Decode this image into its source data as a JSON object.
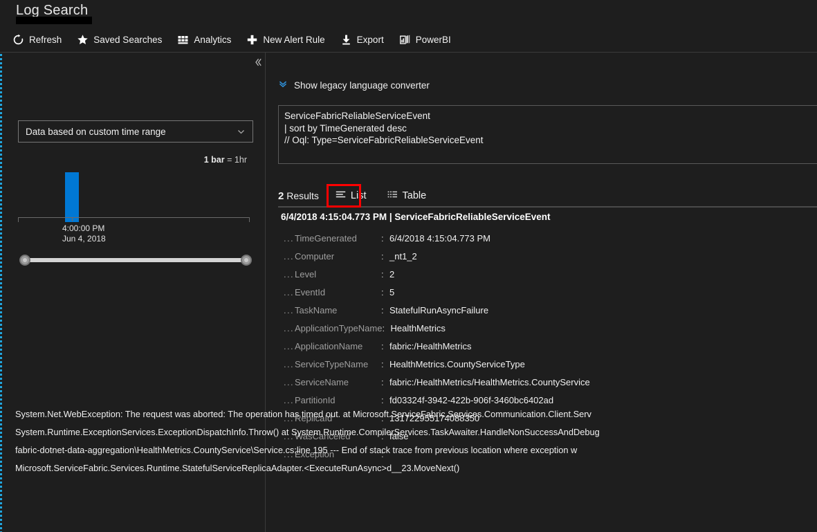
{
  "header": {
    "page_title": "Log Search",
    "redacted": true,
    "toolbar": [
      {
        "label": "Refresh",
        "icon": "refresh-icon"
      },
      {
        "label": "Saved Searches",
        "icon": "star-icon"
      },
      {
        "label": "Analytics",
        "icon": "analytics-icon"
      },
      {
        "label": "New Alert Rule",
        "icon": "plus-icon"
      },
      {
        "label": "Export",
        "icon": "download-icon"
      },
      {
        "label": "PowerBI",
        "icon": "powerbi-icon"
      }
    ]
  },
  "left_pane": {
    "collapse_icon": "chevron-double-left-icon",
    "time_range": {
      "value": "Data based on custom time range",
      "chevron_icon": "chevron-down-icon"
    },
    "bar_unit": {
      "prefix": "1 bar",
      "equals": "=",
      "value": "1hr"
    },
    "axis_label_time": "4:00:00 PM",
    "axis_label_date": "Jun 4, 2018",
    "slider": {
      "left_handle": "range-slider-handle-left",
      "right_handle": "range-slider-handle-right"
    }
  },
  "chart_data": {
    "type": "bar",
    "title": "",
    "categories": [
      "4:00:00 PM Jun 4, 2018"
    ],
    "values": [
      2
    ],
    "bar_unit": "1hr",
    "xlabel": "",
    "ylabel": "",
    "grid": false,
    "legend": "none",
    "series": [
      {
        "name": "Results",
        "values": [
          2
        ]
      }
    ],
    "bar_color": "#0078d4"
  },
  "right_pane": {
    "legacy_converter": {
      "label": "Show legacy language converter",
      "icon": "chevron-double-down-icon"
    },
    "query_lines": [
      "ServiceFabricReliableServiceEvent",
      "| sort by TimeGenerated desc",
      "// Oql: Type=ServiceFabricReliableServiceEvent"
    ],
    "results": {
      "count": "2",
      "count_label": "Results",
      "views": [
        {
          "label": "List",
          "icon": "list-icon",
          "selected": true,
          "highlight": "#ff0000"
        },
        {
          "label": "Table",
          "icon": "table-icon",
          "selected": false
        }
      ]
    },
    "record": {
      "header": "6/4/2018 4:15:04.773 PM | ServiceFabricReliableServiceEvent",
      "dots": "...",
      "colon": ":",
      "fields": [
        {
          "key": "TimeGenerated",
          "value": "6/4/2018 4:15:04.773 PM"
        },
        {
          "key": "Computer",
          "value": "_nt1_2"
        },
        {
          "key": "Level",
          "value": "2"
        },
        {
          "key": "EventId",
          "value": "5"
        },
        {
          "key": "TaskName",
          "value": "StatefulRunAsyncFailure"
        },
        {
          "key": "ApplicationTypeName",
          "value": "HealthMetrics"
        },
        {
          "key": "ApplicationName",
          "value": "fabric:/HealthMetrics"
        },
        {
          "key": "ServiceTypeName",
          "value": "HealthMetrics.CountyServiceType"
        },
        {
          "key": "ServiceName",
          "value": "fabric:/HealthMetrics/HealthMetrics.CountyService"
        },
        {
          "key": "PartitionId",
          "value": "fd03324f-3942-422b-906f-3460bc6402ad"
        },
        {
          "key": "ReplicaId",
          "value": "131722955174088350"
        },
        {
          "key": "WasCanceled",
          "value": "false"
        },
        {
          "key": "Exception",
          "value": ""
        }
      ],
      "exception_lines": [
        "System.Net.WebException: The request was aborted: The operation has timed out. at Microsoft.ServiceFabric.Services.Communication.Client.Serv",
        "System.Runtime.ExceptionServices.ExceptionDispatchInfo.Throw() at System.Runtime.CompilerServices.TaskAwaiter.HandleNonSuccessAndDebug",
        "fabric-dotnet-data-aggregation\\HealthMetrics.CountyService\\Service.cs:line 195 --- End of stack trace from previous location where exception w",
        "Microsoft.ServiceFabric.Services.Runtime.StatefulServiceReplicaAdapter.<ExecuteRunAsync>d__23.MoveNext()"
      ]
    }
  },
  "colors": {
    "background": "#1e1e1e",
    "accent_blue": "#0078d4",
    "annotation_red": "#ff0000",
    "muted_text": "#9e9e9e",
    "edge_handle": "#21a7e0"
  }
}
